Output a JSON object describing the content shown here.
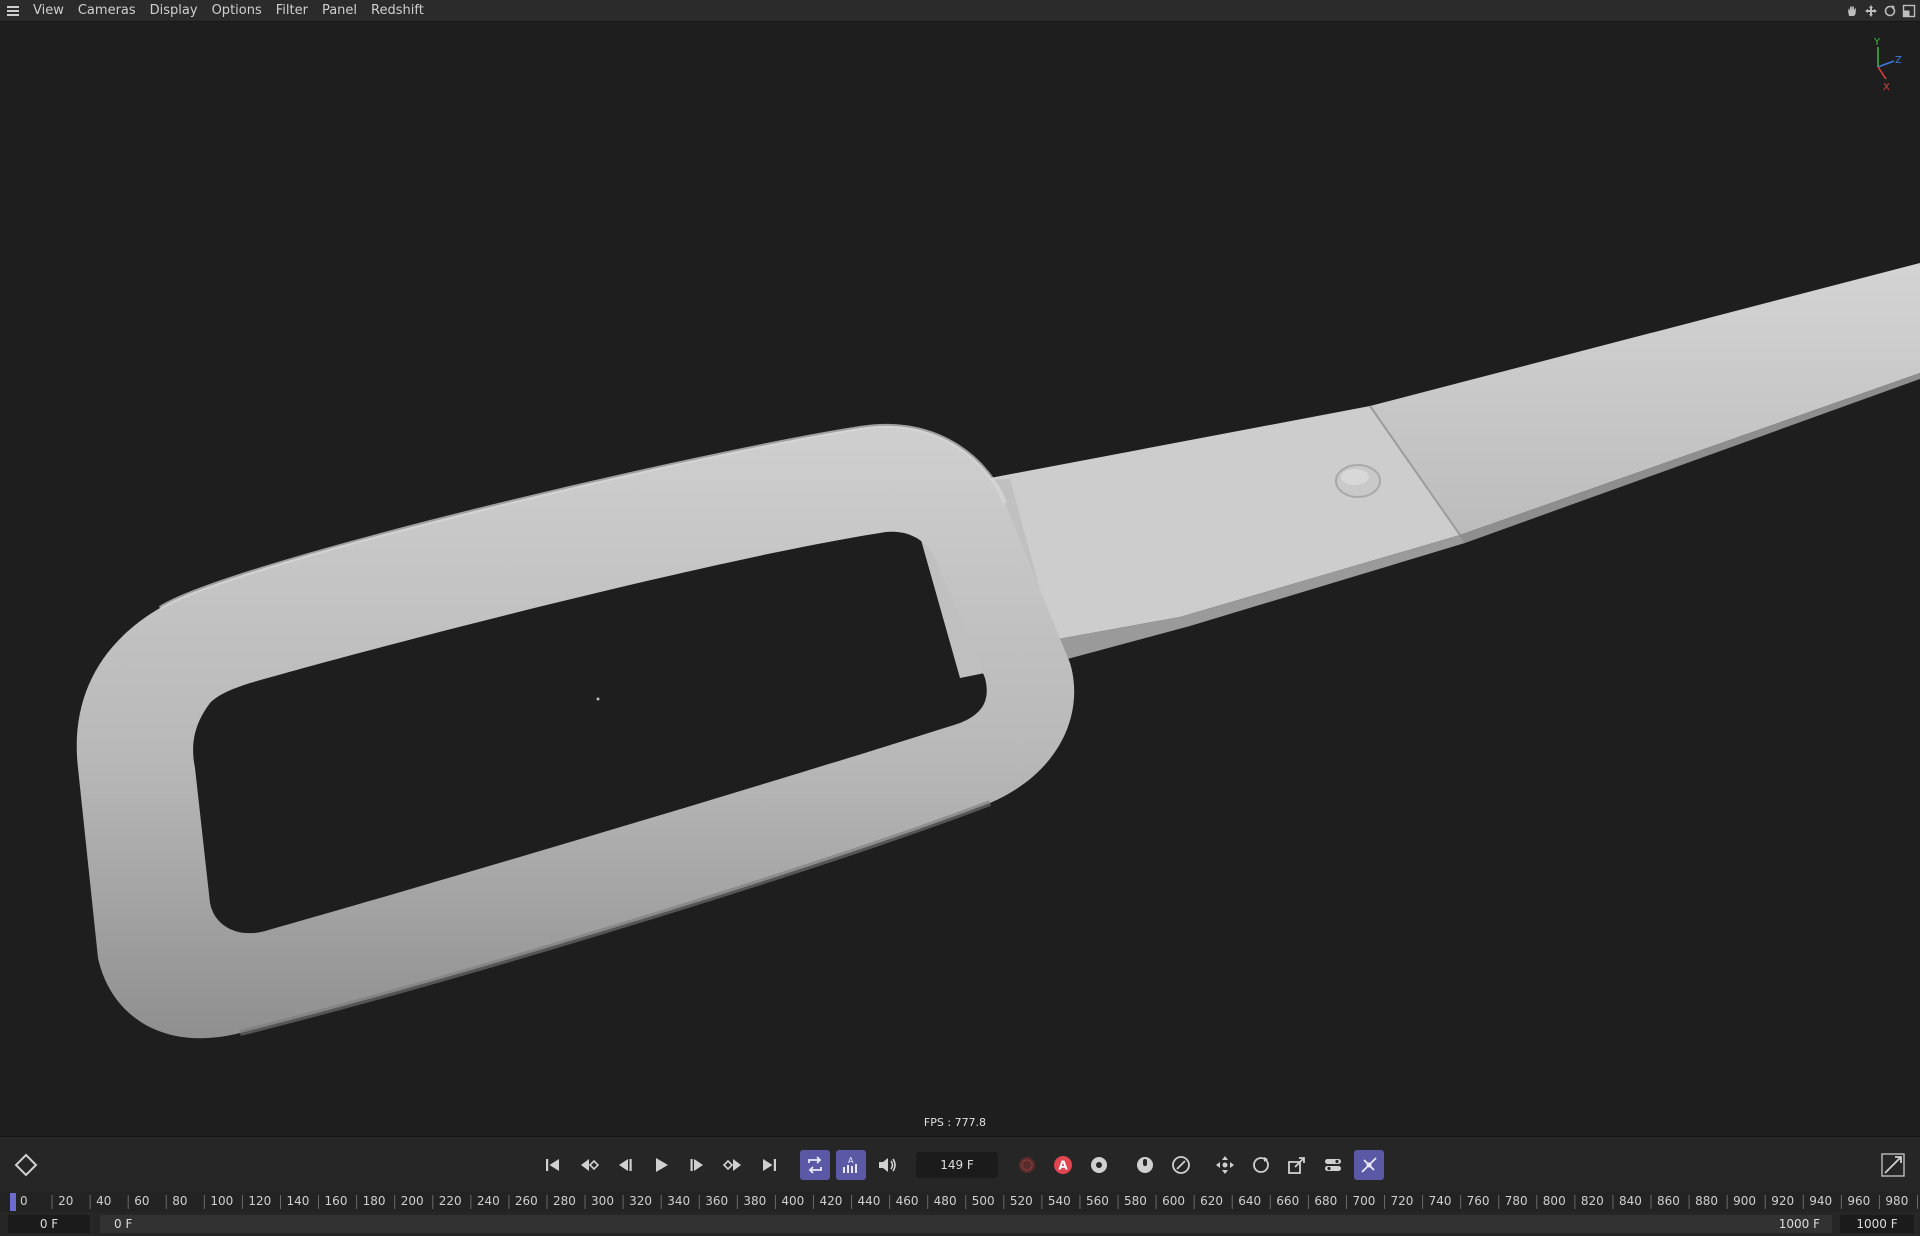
{
  "menubar": {
    "items": [
      "View",
      "Cameras",
      "Display",
      "Options",
      "Filter",
      "Panel",
      "Redshift"
    ],
    "right_icons": [
      "hand-pan-icon",
      "move-icon",
      "rotate-icon",
      "maximize-icon"
    ]
  },
  "viewport": {
    "fps_label": "FPS : 777.8",
    "axis": {
      "y": "Y",
      "z": "Z",
      "x": "X"
    },
    "colors": {
      "background": "#1e1e1e",
      "axis_y": "#3dbf3d",
      "axis_z": "#3d7be0",
      "axis_x": "#e04040"
    }
  },
  "transport": {
    "current_frame": "149 F",
    "buttons": [
      "go-to-start-icon",
      "previous-key-icon",
      "previous-frame-icon",
      "play-icon",
      "next-frame-icon",
      "next-key-icon",
      "go-to-end-icon",
      "loop-icon",
      "autokey-mode-icon",
      "sound-icon",
      "record-icon",
      "autokey-icon",
      "keyframe-settings-icon",
      "keyframe-selection-icon",
      "motion-clip-icon",
      "position-key-icon",
      "rotation-key-icon",
      "scale-key-icon",
      "parameter-key-icon",
      "point-level-key-icon"
    ],
    "active_color": "#5b59a6"
  },
  "ruler": {
    "ticks": [
      "0",
      "20",
      "40",
      "60",
      "80",
      "100",
      "120",
      "140",
      "160",
      "180",
      "200",
      "220",
      "240",
      "260",
      "280",
      "300",
      "320",
      "340",
      "360",
      "380",
      "400",
      "420",
      "440",
      "460",
      "480",
      "500",
      "520",
      "540",
      "560",
      "580",
      "600",
      "620",
      "640",
      "660",
      "680",
      "700",
      "720",
      "740",
      "760",
      "780",
      "800",
      "820",
      "840",
      "860",
      "880",
      "900",
      "920",
      "940",
      "960",
      "980",
      "100"
    ],
    "playhead_frame": 0
  },
  "range": {
    "start": "0 F",
    "slider_start": "0 F",
    "slider_end": "1000 F",
    "end": "1000 F"
  }
}
